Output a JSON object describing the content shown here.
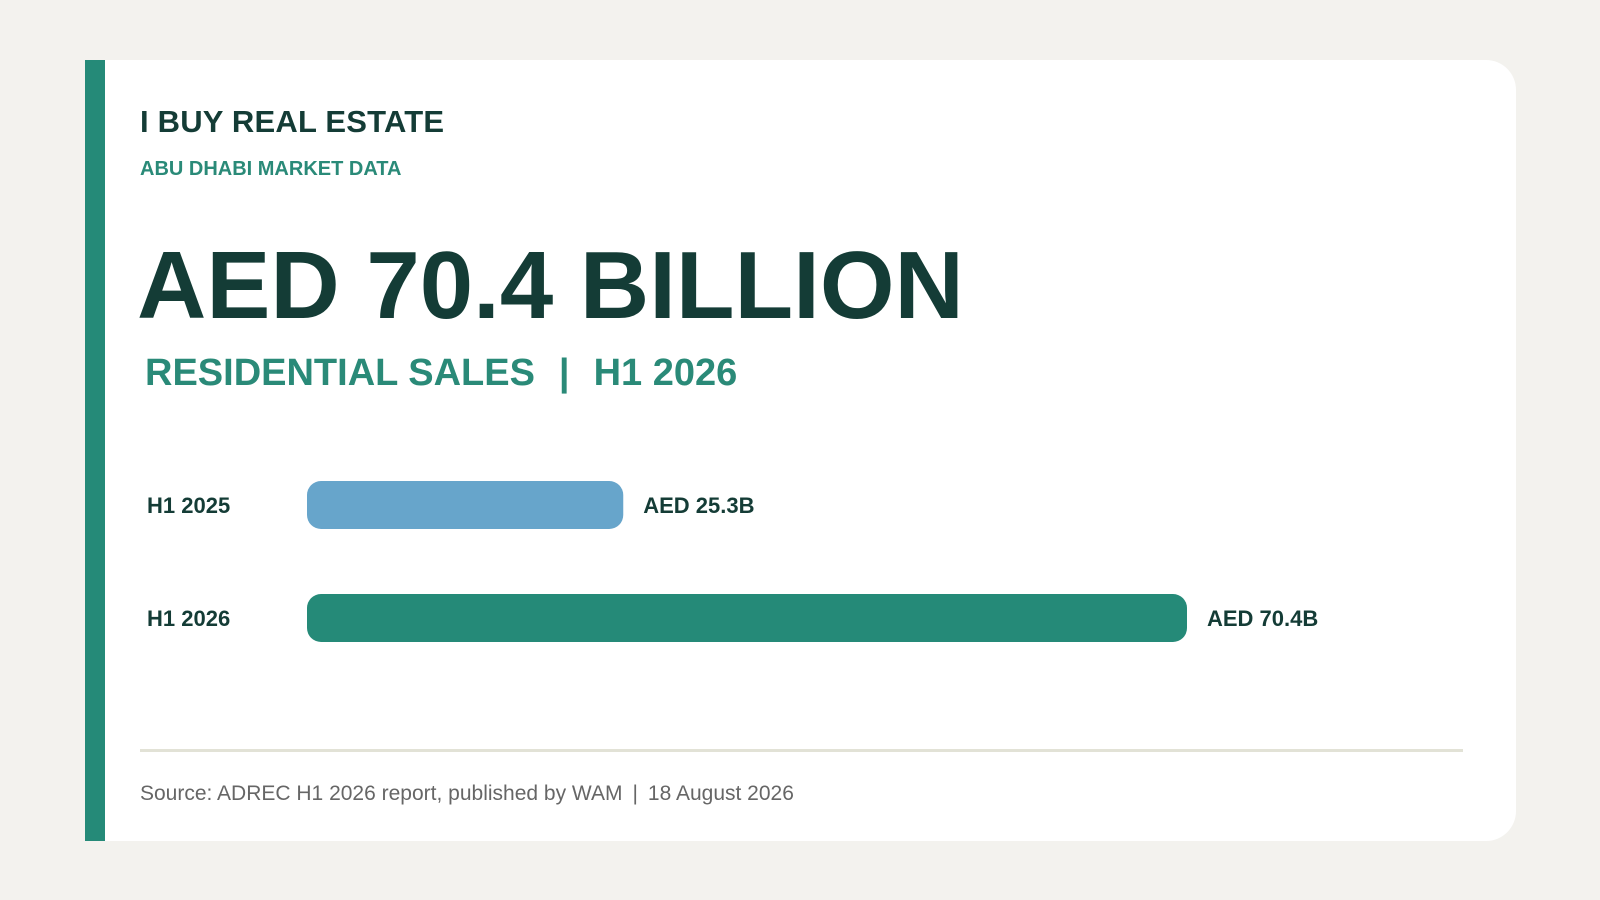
{
  "header": {
    "brand": "I BUY REAL ESTATE",
    "kicker": "ABU DHABI MARKET DATA"
  },
  "headline": {
    "value": "AED 70.4 BILLION",
    "metric": "RESIDENTIAL SALES",
    "separator": "|",
    "period": "H1 2026"
  },
  "footer": {
    "source": "Source: ADREC H1 2026 report, published by WAM",
    "separator": "|",
    "date": "18 August 2026"
  },
  "colors": {
    "accent": "#258a78",
    "dark": "#143c36",
    "bar_2025": "#67a5cb",
    "bar_2026": "#258a78"
  },
  "chart_data": {
    "type": "bar",
    "orientation": "horizontal",
    "categories": [
      "H1 2025",
      "H1 2026"
    ],
    "values": [
      25.3,
      70.4
    ],
    "data_labels": [
      "AED 25.3B",
      "AED 70.4B"
    ],
    "unit": "AED billion",
    "xlim": [
      0,
      70.4
    ],
    "grid": false,
    "bar_colors": [
      "#67a5cb",
      "#258a78"
    ]
  }
}
